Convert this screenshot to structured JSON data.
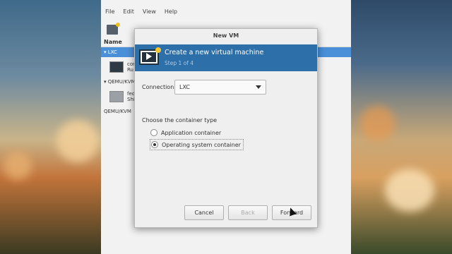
{
  "main_window": {
    "menu": [
      "File",
      "Edit",
      "View",
      "Help"
    ],
    "list_header": "Name",
    "groups": [
      "LXC",
      "QEMU/KVM",
      "QEMU/KVM"
    ],
    "vms": [
      {
        "name": "cor",
        "status": "Ru"
      },
      {
        "name": "fed",
        "status": "Shi"
      }
    ]
  },
  "dialog": {
    "title": "New VM",
    "banner_title": "Create a new virtual machine",
    "banner_step": "Step 1 of 4",
    "connection_label": "Connection:",
    "connection_value": "LXC",
    "container_type_label": "Choose the container type",
    "options": [
      "Application container",
      "Operating system container"
    ],
    "selected_option": "Operating system container",
    "buttons": {
      "cancel": "Cancel",
      "back": "Back",
      "forward": "Forward"
    }
  }
}
